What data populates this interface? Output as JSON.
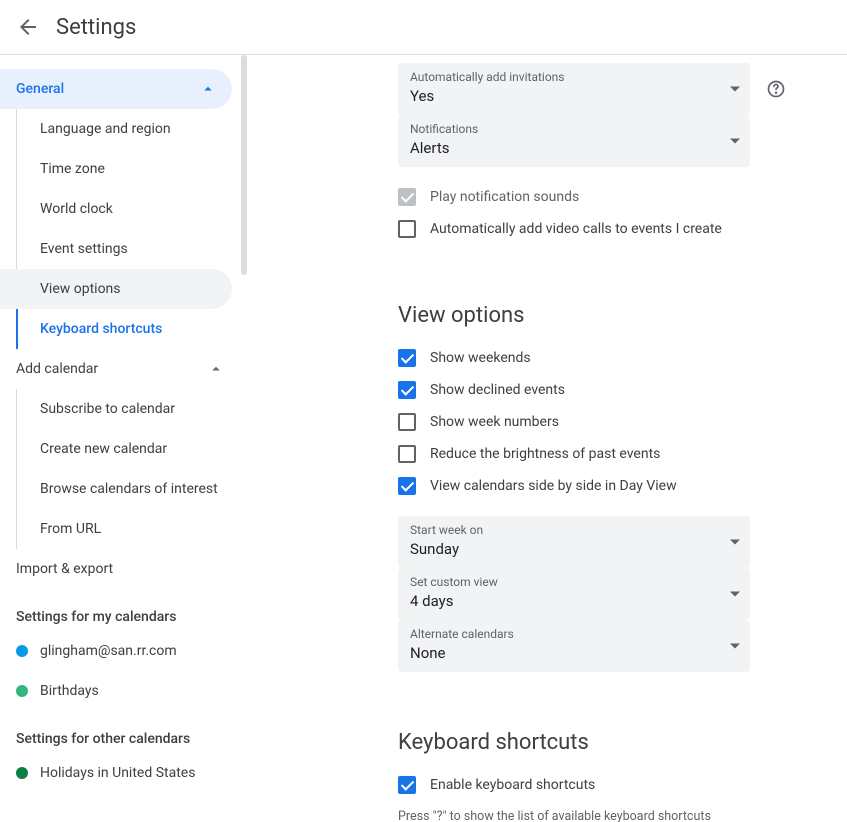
{
  "header": {
    "title": "Settings"
  },
  "sidebar": {
    "general": {
      "label": "General",
      "items": [
        {
          "label": "Language and region"
        },
        {
          "label": "Time zone"
        },
        {
          "label": "World clock"
        },
        {
          "label": "Event settings"
        },
        {
          "label": "View options"
        },
        {
          "label": "Keyboard shortcuts"
        }
      ]
    },
    "add_calendar": {
      "label": "Add calendar",
      "items": [
        {
          "label": "Subscribe to calendar"
        },
        {
          "label": "Create new calendar"
        },
        {
          "label": "Browse calendars of interest"
        },
        {
          "label": "From URL"
        }
      ]
    },
    "import_export": "Import & export",
    "my_cal_title": "Settings for my calendars",
    "my_calendars": [
      {
        "label": "glingham@san.rr.com",
        "color": "#039be5"
      },
      {
        "label": "Birthdays",
        "color": "#33b679"
      }
    ],
    "other_cal_title": "Settings for other calendars",
    "other_calendars": [
      {
        "label": "Holidays in United States",
        "color": "#0b8043"
      }
    ]
  },
  "main": {
    "auto_invite": {
      "label": "Automatically add invitations",
      "value": "Yes"
    },
    "notifications": {
      "label": "Notifications",
      "value": "Alerts"
    },
    "play_sounds": "Play notification sounds",
    "auto_video": "Automatically add video calls to events I create",
    "view_options_h": "View options",
    "show_weekends": "Show weekends",
    "show_declined": "Show declined events",
    "show_week_numbers": "Show week numbers",
    "reduce_brightness": "Reduce the brightness of past events",
    "side_by_side": "View calendars side by side in Day View",
    "start_week": {
      "label": "Start week on",
      "value": "Sunday"
    },
    "custom_view": {
      "label": "Set custom view",
      "value": "4 days"
    },
    "alternate_cal": {
      "label": "Alternate calendars",
      "value": "None"
    },
    "kb_h": "Keyboard shortcuts",
    "enable_kb": "Enable keyboard shortcuts",
    "kb_hint": "Press \"?\" to show the list of available keyboard shortcuts"
  }
}
